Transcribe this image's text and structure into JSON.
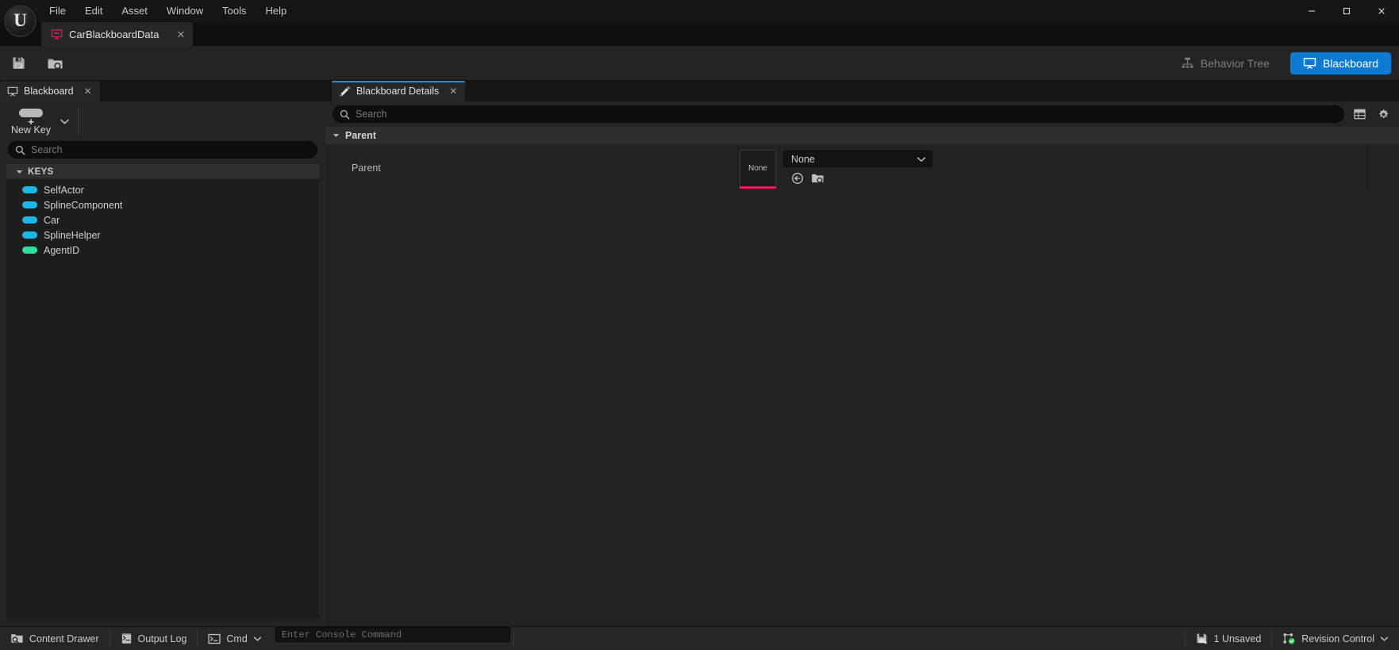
{
  "window": {
    "minimize_label": "—",
    "maximize_label": "□",
    "close_label": "✕"
  },
  "menu": {
    "items": [
      {
        "label": "File"
      },
      {
        "label": "Edit"
      },
      {
        "label": "Asset"
      },
      {
        "label": "Window"
      },
      {
        "label": "Tools"
      },
      {
        "label": "Help"
      }
    ]
  },
  "asset_tab": {
    "label": "CarBlackboardData",
    "close_label": "✕",
    "icon": "blackboard-asset-icon",
    "icon_color": "#e0205e"
  },
  "toolbar": {
    "save_icon": "save-icon",
    "browse_icon": "browse-content-icon",
    "modes": [
      {
        "label": "Behavior Tree",
        "icon": "behavior-tree-icon",
        "active": false
      },
      {
        "label": "Blackboard",
        "icon": "blackboard-icon",
        "active": true
      }
    ],
    "accent_color": "#0c7ad1"
  },
  "left_panel": {
    "tab": {
      "label": "Blackboard",
      "icon": "blackboard-icon",
      "close_label": "✕"
    },
    "new_key": {
      "label": "New Key",
      "caret": "chevron-down-icon"
    },
    "search": {
      "value": "",
      "placeholder": "Search",
      "icon": "search-icon"
    },
    "keys_section": {
      "label": "KEYS",
      "expanded": true
    },
    "keys": [
      {
        "name": "SelfActor",
        "color": "#1db6e8",
        "type": "object"
      },
      {
        "name": "SplineComponent",
        "color": "#1db6e8",
        "type": "object"
      },
      {
        "name": "Car",
        "color": "#1db6e8",
        "type": "object"
      },
      {
        "name": "SplineHelper",
        "color": "#1db6e8",
        "type": "object"
      },
      {
        "name": "AgentID",
        "color": "#2ee0a0",
        "type": "name"
      }
    ]
  },
  "details_panel": {
    "tab": {
      "label": "Blackboard Details",
      "icon": "details-edit-icon",
      "close_label": "✕"
    },
    "search": {
      "value": "",
      "placeholder": "Search",
      "icon": "search-icon"
    },
    "view_options_icon": "table-view-icon",
    "settings_icon": "gear-icon",
    "section": {
      "label": "Parent",
      "expanded": true
    },
    "parent_row": {
      "name": "Parent",
      "thumbnail_label": "None",
      "thumbnail_accent": "#e0205e",
      "combo_value": "None",
      "combo_caret": "chevron-down-icon",
      "use_selected_icon": "use-selected-asset-icon",
      "browse_icon": "browse-to-asset-icon"
    }
  },
  "statusbar": {
    "content_drawer": {
      "label": "Content Drawer",
      "icon": "content-drawer-icon"
    },
    "output_log": {
      "label": "Output Log",
      "icon": "output-log-icon"
    },
    "cmd": {
      "label": "Cmd",
      "icon": "cmd-icon",
      "caret": "chevron-down-icon"
    },
    "console": {
      "value": "",
      "placeholder": "Enter Console Command"
    },
    "unsaved": {
      "label": "1 Unsaved",
      "icon": "unsaved-save-icon"
    },
    "revision_control": {
      "label": "Revision Control",
      "icon": "revision-control-icon",
      "caret": "chevron-down-icon",
      "status_color": "#2fbf4a"
    }
  }
}
